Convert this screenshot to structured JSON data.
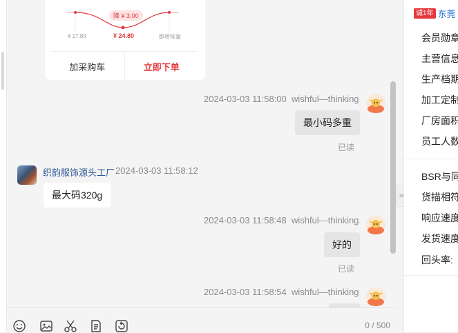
{
  "product_card": {
    "price_left": "¥ 27.80",
    "price_mid": "¥ 24.80",
    "price_right": "即将恢复",
    "drop_badge": "降 ¥ 3.00",
    "add_cart": "加采购车",
    "buy_now": "立即下单"
  },
  "messages": [
    {
      "time": "2024-03-03 11:58:00",
      "sender": "wishful—thinking",
      "text": "最小码多重",
      "status": "已读"
    },
    {
      "time": "2024-03-03 11:58:12",
      "sender": "织韵服饰源头工厂",
      "text": "最大码320g"
    },
    {
      "time": "2024-03-03 11:58:48",
      "sender": "wishful—thinking",
      "text": "好的",
      "status": "已读"
    },
    {
      "time": "2024-03-03 11:58:54",
      "sender": "wishful—thinking"
    }
  ],
  "composer": {
    "counter": "0 / 500"
  },
  "toolbar_icons": [
    "emoji-icon",
    "image-icon",
    "scissors-icon",
    "document-icon",
    "history-icon"
  ],
  "side_panel": {
    "year_badge": "诚1年",
    "shop_name": "东莞",
    "rows_a": [
      "会员勋章",
      "主营信息",
      "生产档期",
      "加工定制",
      "厂房面积",
      "员工人数"
    ],
    "rows_b": [
      "BSR与同行",
      "货描相符",
      "响应速度",
      "发货速度",
      "回头率:"
    ]
  },
  "colors": {
    "accent_red": "#e4393c",
    "link_blue": "#2b5797",
    "bubble_out": "#e5e5e5"
  }
}
